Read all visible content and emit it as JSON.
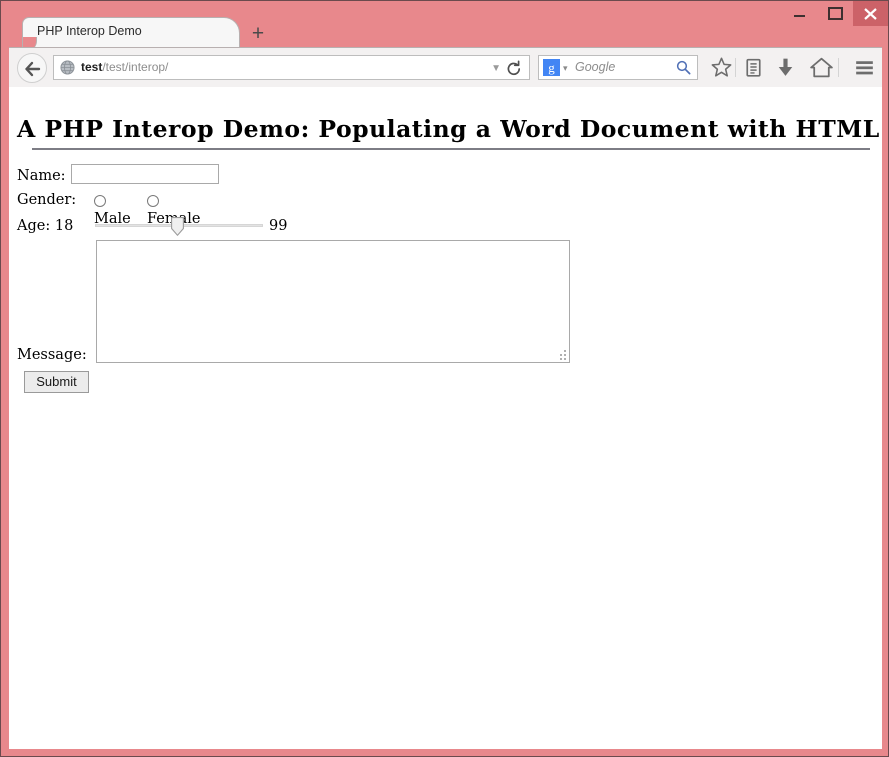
{
  "window": {
    "frame_color": "#e8888c",
    "controls": {
      "minimize_label": "minimize",
      "maximize_label": "maximize",
      "close_label": "close",
      "close_bg": "#cc6268"
    }
  },
  "browser": {
    "tab": {
      "title": "PHP Interop Demo",
      "new_tab_label": "+"
    },
    "nav": {
      "back_icon": "back-arrow-icon",
      "favicon": "globe-favicon",
      "url_domain": "test",
      "url_path": "/test/interop/",
      "url_dropdown_glyph": "▼",
      "reload_glyph": "⟳"
    },
    "search": {
      "engine_initial": "g",
      "engine_color": "#4285f4",
      "caret_glyph": "▾",
      "placeholder": "Google",
      "go_icon": "magnifier-icon"
    },
    "toolbar_icons": [
      {
        "name": "bookmark-star-icon",
        "label": "Bookmark this page"
      },
      {
        "name": "reading-list-icon",
        "label": "Reading list"
      },
      {
        "name": "downloads-icon",
        "label": "Downloads"
      },
      {
        "name": "home-icon",
        "label": "Home"
      },
      {
        "name": "menu-hamburger-icon",
        "label": "Open menu"
      }
    ]
  },
  "page": {
    "heading": "A PHP Interop Demo: Populating a Word Document with HTML form input",
    "form": {
      "name": {
        "label": "Name:",
        "value": "",
        "placeholder": ""
      },
      "gender": {
        "label": "Gender:",
        "options": [
          {
            "label": "Male",
            "checked": false
          },
          {
            "label": "Female",
            "checked": false
          }
        ]
      },
      "age": {
        "label": "Age:",
        "min_label": "18",
        "max_label": "99",
        "min": 18,
        "max": 99,
        "value": 57
      },
      "message": {
        "label": "Message:",
        "value": "",
        "placeholder": ""
      },
      "submit_label": "Submit"
    }
  }
}
